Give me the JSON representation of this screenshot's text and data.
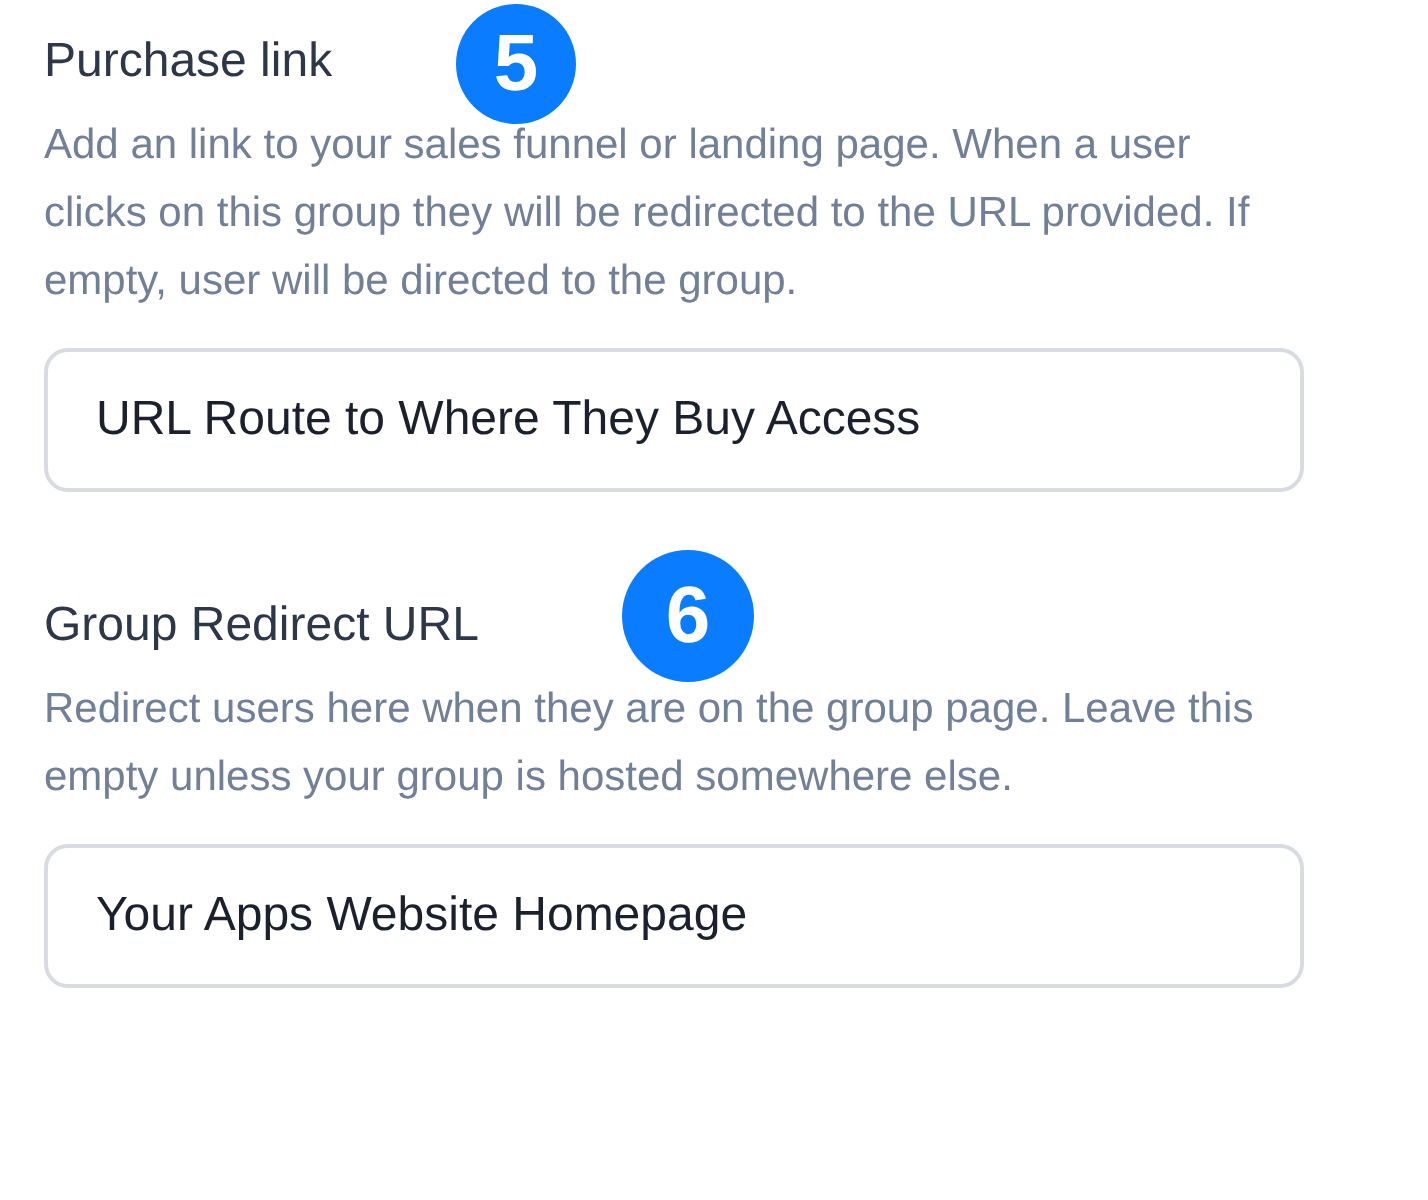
{
  "sections": [
    {
      "label": "Purchase link",
      "badge": "5",
      "description": "Add an link to your sales funnel or landing page. When a user clicks on this group they will be redirected to the URL provided. If empty, user will be directed to the group.",
      "value": "URL Route to Where They Buy Access"
    },
    {
      "label": "Group Redirect URL",
      "badge": "6",
      "description": "Redirect users here when they are on the group page. Leave this empty unless your group is hosted somewhere else.",
      "value": "Your Apps Website Homepage"
    }
  ]
}
